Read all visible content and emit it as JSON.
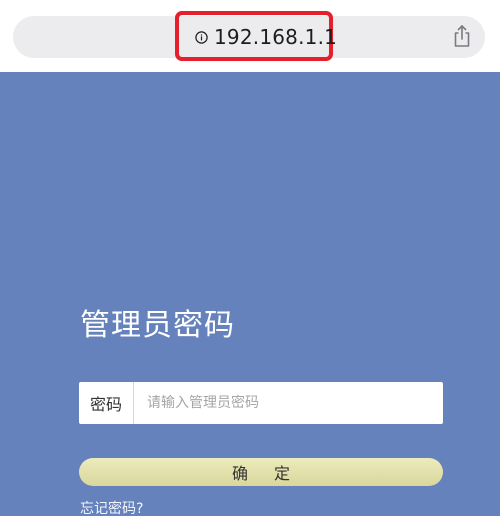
{
  "browser": {
    "url": "192.168.1.1",
    "info_icon": "info-circle-icon",
    "share_icon": "share-icon",
    "highlight_color": "#e5202c"
  },
  "page": {
    "background_color": "#6582bc",
    "title": "管理员密码",
    "password_label": "密码",
    "password_placeholder": "请输入管理员密码",
    "password_value": "",
    "confirm_label": "确定",
    "forgot_link": "忘记密码?"
  }
}
